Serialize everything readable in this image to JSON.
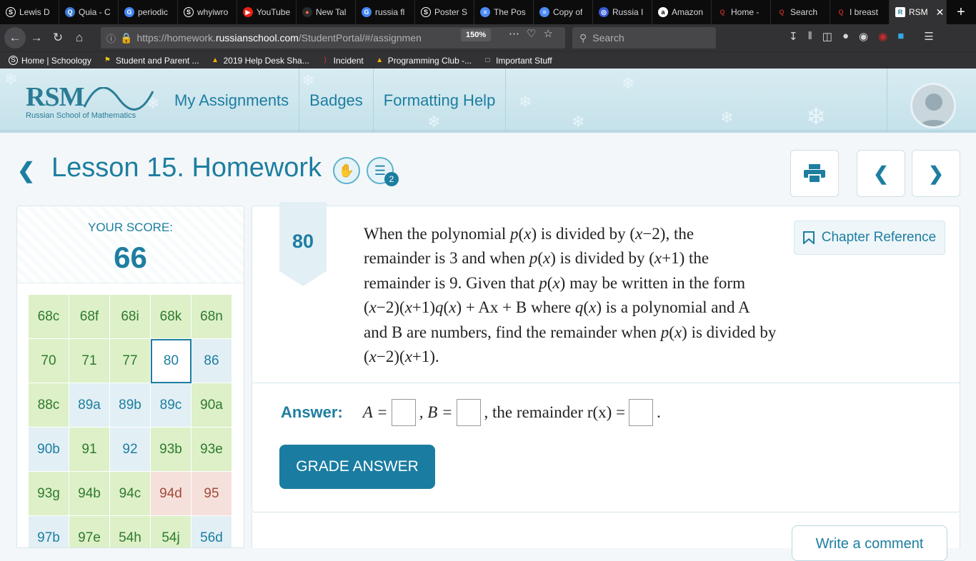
{
  "browser": {
    "tabs": [
      {
        "label": "Lewis D",
        "icon": "schoology-icon",
        "color": "#ffffff"
      },
      {
        "label": "Quia - C",
        "icon": "quia-icon",
        "color": "#3a7bd5"
      },
      {
        "label": "periodic",
        "icon": "google-icon",
        "color": "#4285f4"
      },
      {
        "label": "whyiwro",
        "icon": "schoology-icon",
        "color": "#ffffff"
      },
      {
        "label": "YouTube",
        "icon": "youtube-icon",
        "color": "#e62117"
      },
      {
        "label": "New Tal",
        "icon": "firefox-icon",
        "color": "#ff7139"
      },
      {
        "label": "russia fl",
        "icon": "google-icon",
        "color": "#4285f4"
      },
      {
        "label": "Poster S",
        "icon": "schoology-icon",
        "color": "#ffffff"
      },
      {
        "label": "The Pos",
        "icon": "docs-icon",
        "color": "#4c8bf5"
      },
      {
        "label": "Copy of",
        "icon": "docs-icon",
        "color": "#4c8bf5"
      },
      {
        "label": "Russia I",
        "icon": "globe-icon",
        "color": "#3a5bd5"
      },
      {
        "label": "Amazon",
        "icon": "amazon-icon",
        "color": "#ffffff"
      },
      {
        "label": "Home -",
        "icon": "quora-icon",
        "color": "#b92b27"
      },
      {
        "label": "Search",
        "icon": "quora-icon",
        "color": "#b92b27"
      },
      {
        "label": "I breast",
        "icon": "quora-icon",
        "color": "#b92b27"
      }
    ],
    "active_tab": {
      "label": "RSM",
      "icon": "rsm-icon"
    },
    "url_prefix": "https://homework.",
    "url_domain": "russianschool.com",
    "url_path": "/StudentPortal/#/assignmen",
    "zoom": "150%",
    "search_placeholder": "Search",
    "bookmarks": [
      {
        "label": "Home | Schoology",
        "icon": "schoology-icon"
      },
      {
        "label": "Student and Parent ...",
        "icon": "flag-icon"
      },
      {
        "label": "2019 Help Desk Sha...",
        "icon": "drive-icon"
      },
      {
        "label": "Incident",
        "icon": "incident-icon"
      },
      {
        "label": "Programming Club -...",
        "icon": "drive-icon"
      },
      {
        "label": "Important Stuff",
        "icon": "folder-icon"
      }
    ]
  },
  "site": {
    "logo_text": "RSM",
    "logo_tagline": "Russian School of Mathematics",
    "nav": [
      "My Assignments",
      "Badges",
      "Formatting Help"
    ]
  },
  "lesson": {
    "title": "Lesson 15. Homework",
    "badge_count": "2"
  },
  "score": {
    "label": "YOUR SCORE:",
    "value": "66",
    "problems": [
      {
        "id": "68c",
        "status": "green"
      },
      {
        "id": "68f",
        "status": "green"
      },
      {
        "id": "68i",
        "status": "green"
      },
      {
        "id": "68k",
        "status": "green"
      },
      {
        "id": "68n",
        "status": "green"
      },
      {
        "id": "70",
        "status": "green"
      },
      {
        "id": "71",
        "status": "green"
      },
      {
        "id": "77",
        "status": "green"
      },
      {
        "id": "80",
        "status": "current"
      },
      {
        "id": "86",
        "status": "blue"
      },
      {
        "id": "88c",
        "status": "green"
      },
      {
        "id": "89a",
        "status": "blue"
      },
      {
        "id": "89b",
        "status": "blue"
      },
      {
        "id": "89c",
        "status": "blue"
      },
      {
        "id": "90a",
        "status": "green"
      },
      {
        "id": "90b",
        "status": "blue"
      },
      {
        "id": "91",
        "status": "green"
      },
      {
        "id": "92",
        "status": "blue"
      },
      {
        "id": "93b",
        "status": "green"
      },
      {
        "id": "93e",
        "status": "green"
      },
      {
        "id": "93g",
        "status": "green"
      },
      {
        "id": "94b",
        "status": "green"
      },
      {
        "id": "94c",
        "status": "green"
      },
      {
        "id": "94d",
        "status": "red"
      },
      {
        "id": "95",
        "status": "red"
      },
      {
        "id": "97b",
        "status": "blue"
      },
      {
        "id": "97e",
        "status": "green"
      },
      {
        "id": "54h",
        "status": "green"
      },
      {
        "id": "54j",
        "status": "green"
      },
      {
        "id": "56d",
        "status": "blue"
      }
    ]
  },
  "problem": {
    "number": "80",
    "chapter_reference": "Chapter Reference",
    "answer_label": "Answer:",
    "a_label": "A =",
    "b_label": ", B =",
    "remainder_label": ", the remainder r(x) =",
    "end_mark": ".",
    "grade_button": "GRADE ANSWER",
    "comment_button": "Write a comment"
  },
  "colors": {
    "accent": "#1d7ea0",
    "correct": "#ddf0c8",
    "incorrect": "#f6e0dc",
    "pending": "#e2eff5"
  }
}
